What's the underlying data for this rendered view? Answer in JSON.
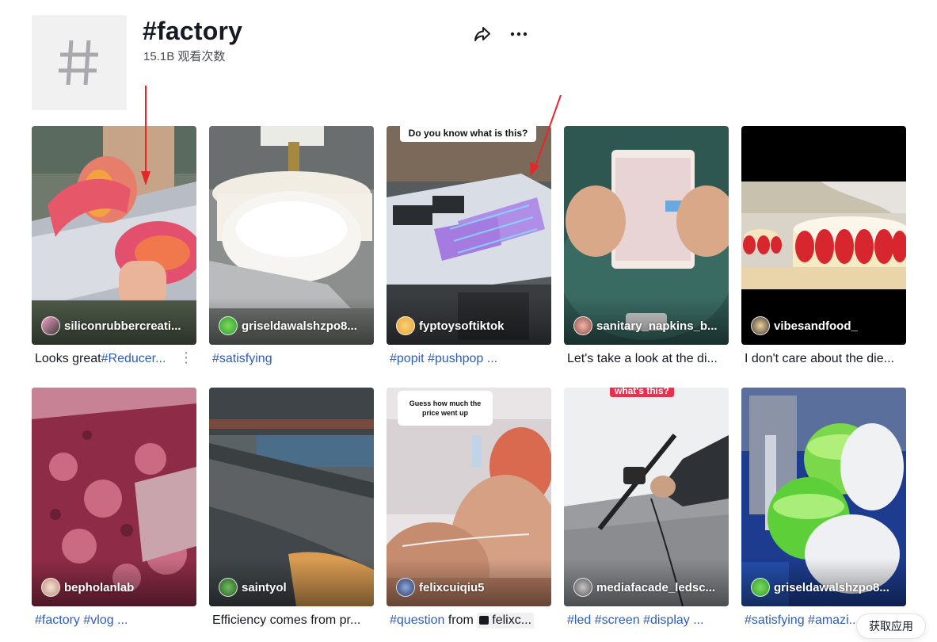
{
  "header": {
    "title": "#factory",
    "views": "15.1B 观看次数",
    "icons": [
      "share-icon",
      "more-icon"
    ]
  },
  "videos": [
    {
      "author": "siliconrubbercreati...",
      "caption_text": "Looks great",
      "caption_tags": "#Reducer...",
      "has_more": true,
      "has_more_label": "⋮"
    },
    {
      "author": "griseldawalshzpo8...",
      "caption_text": "",
      "caption_tags": "#satisfying"
    },
    {
      "author": "fyptoysoftiktok",
      "caption_text": "",
      "caption_tags": "#popit #pushpop ...",
      "overlay": "Do you know what is this?"
    },
    {
      "author": "sanitary_napkins_b...",
      "caption_text": "Let's take a look at the di...",
      "caption_tags": ""
    },
    {
      "author": "vibesandfood_",
      "caption_text": "I don't care about the die...",
      "caption_tags": ""
    },
    {
      "author": "bepholanlab",
      "caption_text": "",
      "caption_tags": "#factory #vlog ..."
    },
    {
      "author": "saintyol",
      "caption_text": "Efficiency comes from pr...",
      "caption_tags": ""
    },
    {
      "author": "felixcuiqiu5",
      "caption_tags": "#question",
      "caption_from": " from ",
      "caption_chip": "felixc...",
      "overlay": "Guess how much the price went up"
    },
    {
      "author": "mediafacade_ledsc...",
      "caption_text": "",
      "caption_tags": "#led #screen #display ...",
      "overlay": "what's this?"
    },
    {
      "author": "griseldawalshzpo8...",
      "caption_text": "",
      "caption_tags": "#satisfying #amazi..."
    }
  ],
  "get_app": "获取应用",
  "colors": {
    "hashtag": "#2b5db9",
    "annotation_arrow": "#e8262a"
  }
}
